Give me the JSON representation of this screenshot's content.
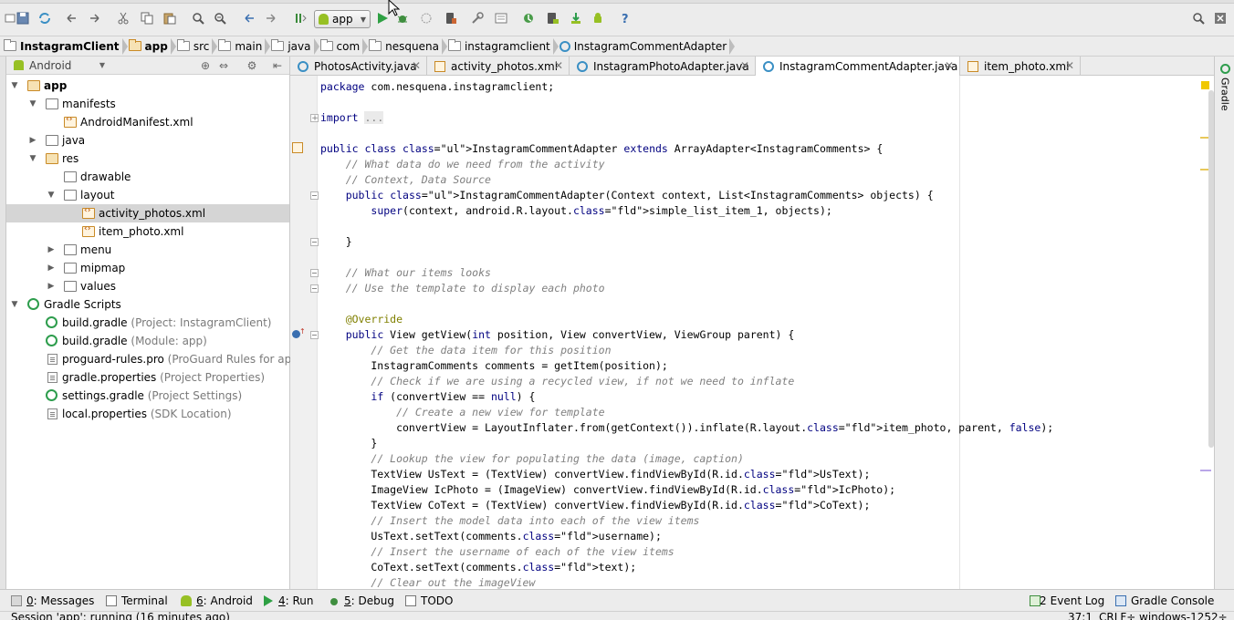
{
  "toolbar": {
    "run_config": "app"
  },
  "breadcrumb": [
    "InstagramClient",
    "app",
    "src",
    "main",
    "java",
    "com",
    "nesquena",
    "instagramclient",
    "InstagramCommentAdapter"
  ],
  "project_panel": {
    "view": "Android",
    "tree": [
      {
        "label": "app",
        "hint": ""
      },
      {
        "label": "manifests",
        "hint": ""
      },
      {
        "label": "AndroidManifest.xml",
        "hint": ""
      },
      {
        "label": "java",
        "hint": ""
      },
      {
        "label": "res",
        "hint": ""
      },
      {
        "label": "drawable",
        "hint": ""
      },
      {
        "label": "layout",
        "hint": ""
      },
      {
        "label": "activity_photos.xml",
        "hint": ""
      },
      {
        "label": "item_photo.xml",
        "hint": ""
      },
      {
        "label": "menu",
        "hint": ""
      },
      {
        "label": "mipmap",
        "hint": ""
      },
      {
        "label": "values",
        "hint": ""
      },
      {
        "label": "Gradle Scripts",
        "hint": ""
      },
      {
        "label": "build.gradle",
        "hint": "(Project: InstagramClient)"
      },
      {
        "label": "build.gradle",
        "hint": "(Module: app)"
      },
      {
        "label": "proguard-rules.pro",
        "hint": "(ProGuard Rules for app)"
      },
      {
        "label": "gradle.properties",
        "hint": "(Project Properties)"
      },
      {
        "label": "settings.gradle",
        "hint": "(Project Settings)"
      },
      {
        "label": "local.properties",
        "hint": "(SDK Location)"
      }
    ]
  },
  "tabs": [
    {
      "label": "PhotosActivity.java"
    },
    {
      "label": "activity_photos.xml"
    },
    {
      "label": "InstagramPhotoAdapter.java"
    },
    {
      "label": "InstagramCommentAdapter.java"
    },
    {
      "label": "item_photo.xml"
    }
  ],
  "code": [
    {
      "text": "package com.nesquena.instagramclient;"
    },
    {
      "text": ""
    },
    {
      "text": "import ..."
    },
    {
      "text": ""
    },
    {
      "text": "public class InstagramCommentAdapter extends ArrayAdapter<InstagramComments> {"
    },
    {
      "text": "    // What data do we need from the activity"
    },
    {
      "text": "    // Context, Data Source"
    },
    {
      "text": "    public InstagramCommentAdapter(Context context, List<InstagramComments> objects) {"
    },
    {
      "text": "        super(context, android.R.layout.simple_list_item_1, objects);"
    },
    {
      "text": ""
    },
    {
      "text": "    }"
    },
    {
      "text": ""
    },
    {
      "text": "    // What our items looks"
    },
    {
      "text": "    // Use the template to display each photo"
    },
    {
      "text": ""
    },
    {
      "text": "    @Override"
    },
    {
      "text": "    public View getView(int position, View convertView, ViewGroup parent) {"
    },
    {
      "text": "        // Get the data item for this position"
    },
    {
      "text": "        InstagramComments comments = getItem(position);"
    },
    {
      "text": "        // Check if we are using a recycled view, if not we need to inflate"
    },
    {
      "text": "        if (convertView == null) {"
    },
    {
      "text": "            // Create a new view for template"
    },
    {
      "text": "            convertView = LayoutInflater.from(getContext()).inflate(R.layout.item_photo, parent, false);"
    },
    {
      "text": "        }"
    },
    {
      "text": "        // Lookup the view for populating the data (image, caption)"
    },
    {
      "text": "        TextView UsText = (TextView) convertView.findViewById(R.id.UsText);"
    },
    {
      "text": "        ImageView IcPhoto = (ImageView) convertView.findViewById(R.id.IcPhoto);"
    },
    {
      "text": "        TextView CoText = (TextView) convertView.findViewById(R.id.CoText);"
    },
    {
      "text": "        // Insert the model data into each of the view items"
    },
    {
      "text": "        UsText.setText(comments.username);"
    },
    {
      "text": "        // Insert the username of each of the view items"
    },
    {
      "text": "        CoText.setText(comments.text);"
    },
    {
      "text": "        // Clear out the imageView"
    }
  ],
  "right_tool": {
    "label": "Gradle"
  },
  "bottom_tools": {
    "messages_key": "0",
    "messages": ": Messages",
    "terminal": "Terminal",
    "android_key": "6",
    "android": ": Android",
    "run_key": "4",
    "run": ": Run",
    "debug_key": "5",
    "debug": ": Debug",
    "todo": "TODO",
    "event_log_count": "2",
    "event_log": "Event Log",
    "gradle_console": "Gradle Console"
  },
  "status": {
    "message": "Session 'app': running (16 minutes ago)",
    "position": "37:1",
    "line_sep": "CRLF÷",
    "encoding": "windows-1252÷"
  },
  "colors": {
    "keyword": "#000080",
    "comment": "#808080",
    "annotation": "#808000",
    "field": "#660e7a"
  }
}
